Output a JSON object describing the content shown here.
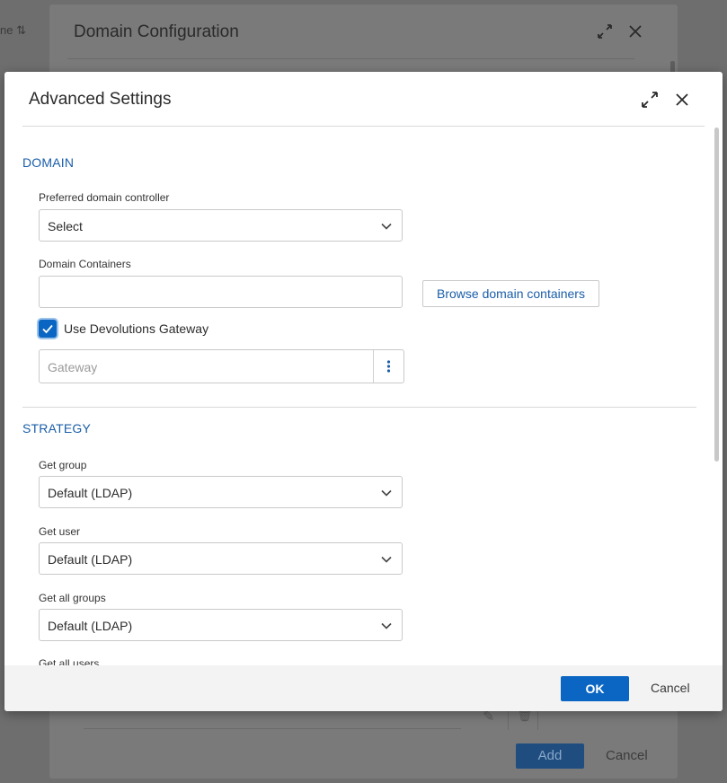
{
  "background": {
    "hint_text": "ne ⇅",
    "dialog_title": "Domain Configuration",
    "add_label": "Add",
    "cancel_label": "Cancel"
  },
  "dialog": {
    "title": "Advanced Settings",
    "domain_section": {
      "title": "DOMAIN",
      "preferred_dc": {
        "label": "Preferred domain controller",
        "value": "Select"
      },
      "domain_containers": {
        "label": "Domain Containers",
        "value": "",
        "browse_label": "Browse domain containers"
      },
      "use_gateway": {
        "label": "Use Devolutions Gateway",
        "checked": true
      },
      "gateway": {
        "placeholder": "Gateway"
      }
    },
    "strategy_section": {
      "title": "STRATEGY",
      "get_group": {
        "label": "Get group",
        "value": "Default (LDAP)"
      },
      "get_user": {
        "label": "Get user",
        "value": "Default (LDAP)"
      },
      "get_all_groups": {
        "label": "Get all groups",
        "value": "Default (LDAP)"
      },
      "get_all_users": {
        "label": "Get all users"
      }
    },
    "footer": {
      "ok_label": "OK",
      "cancel_label": "Cancel"
    }
  },
  "colors": {
    "accent": "#0a66c2",
    "section": "#1a5ea8"
  },
  "icons": [
    "expand-icon",
    "close-icon",
    "chevron-down-icon",
    "check-icon",
    "more-vertical-icon",
    "pencil-icon",
    "trash-icon"
  ]
}
